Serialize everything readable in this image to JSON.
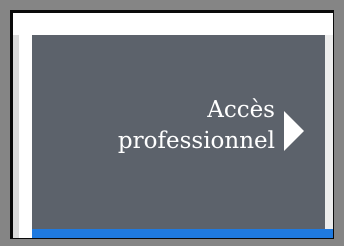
{
  "tile": {
    "line1": "Accès",
    "line2": "professionnel"
  },
  "icons": {
    "arrow": "chevron-right-triangle"
  },
  "colors": {
    "tile_background": "#5c626b",
    "accent_bar": "#1f7ae0",
    "text": "#ffffff"
  }
}
